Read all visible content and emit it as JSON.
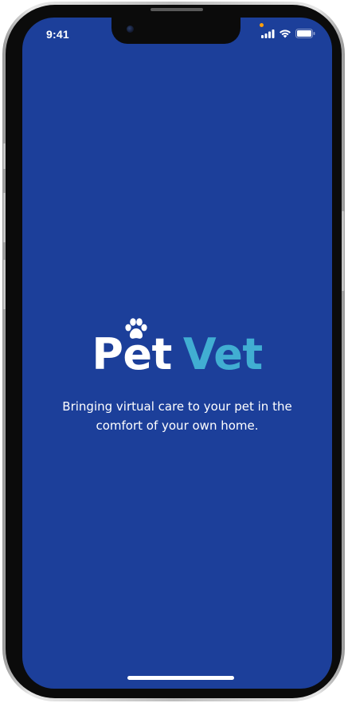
{
  "status_bar": {
    "time": "9:41",
    "icons": [
      "signal-icon",
      "wifi-icon",
      "battery-icon"
    ],
    "privacy_indicator_color": "#ff9f0a"
  },
  "splash": {
    "logo_part1": "Pet",
    "logo_part2": "Vet",
    "logo_part1_color": "#ffffff",
    "logo_part2_color": "#41aed2",
    "tagline": "Bringing virtual care to your pet in the comfort of your own home.",
    "background_color": "#1c3f9a"
  }
}
